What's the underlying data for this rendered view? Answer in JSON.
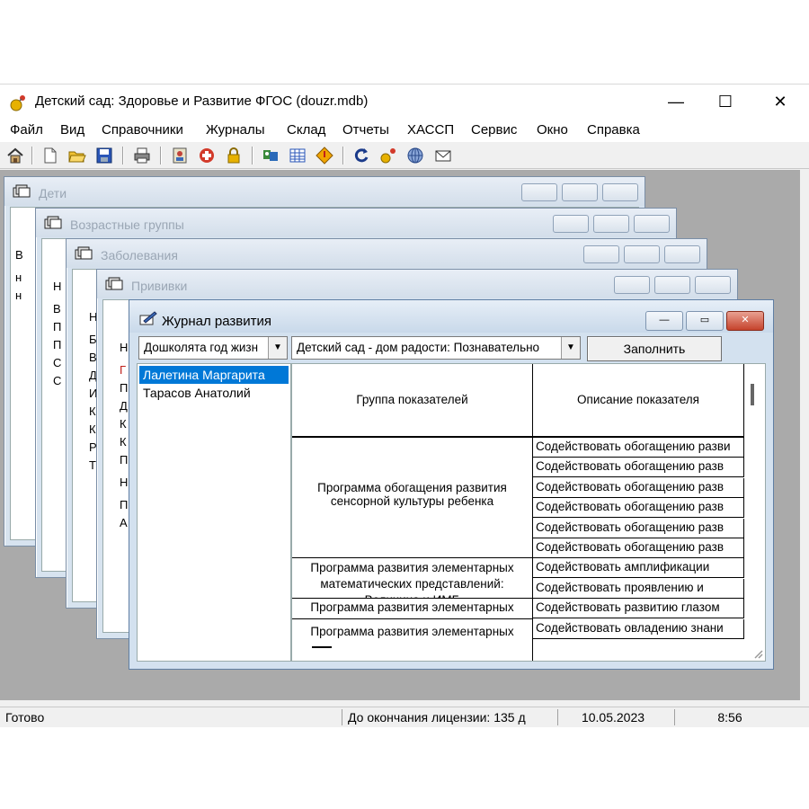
{
  "app": {
    "title": "Детский сад: Здоровье и Развитие ФГОС (douzr.mdb)",
    "controls": {
      "minimize": "—",
      "maximize": "☐",
      "close": "✕"
    }
  },
  "menu": [
    "Файл",
    "Вид",
    "Справочники",
    "Журналы",
    "Склад",
    "Отчеты",
    "ХАССП",
    "Сервис",
    "Окно",
    "Справка"
  ],
  "toolbar_icons": [
    "home-icon",
    "new-icon",
    "open-folder-icon",
    "save-icon",
    "print-icon",
    "user-card-icon",
    "medical-icon",
    "lock-icon",
    "users-icon",
    "table-icon",
    "diamond-icon",
    "refresh-icon",
    "key-icon",
    "network-icon",
    "mail-icon"
  ],
  "background_windows": [
    {
      "title": "Дети",
      "rows": [
        "В",
        "н",
        "н"
      ]
    },
    {
      "title": "Возрастные группы",
      "rows": [
        "Н",
        "В",
        "П",
        "П",
        "С",
        "С"
      ]
    },
    {
      "title": "Заболевания",
      "rows": [
        "Н",
        "Б",
        "В",
        "Д",
        "И",
        "К",
        "К",
        "Р",
        "Т"
      ]
    },
    {
      "title": "Прививки",
      "rows": [
        "Н",
        "Г",
        "П",
        "Д",
        "К",
        "К",
        "П",
        "Н",
        "П",
        "А"
      ]
    }
  ],
  "main_window": {
    "title": "Журнал развития",
    "controls": {
      "minimize": "—",
      "restore": "▭",
      "close": "✕"
    },
    "combo_age": "Дошколята год жизн",
    "combo_program": "Детский сад - дом радости: Познавательно",
    "fill_button": "Заполнить",
    "children": [
      "Лалетина Маргарита",
      "Тарасов Анатолий"
    ],
    "grid": {
      "headers": [
        "Группа показателей",
        "Описание показателя"
      ],
      "groups": [
        "Программа обогащения развития сенсорной культуры ребенка",
        "Программа развития элементарных математических представлений: Величина и ИМБ",
        "Программа развития элементарных",
        "Программа развития элементарных"
      ],
      "descriptions": [
        "Содействовать обогащению разви",
        "Содействовать обогащению разв",
        "Содействовать обогащению разв",
        "Содействовать обогащению разв",
        "Содействовать обогащению разв",
        "Содействовать обогащению разв",
        "Содействовать амплификации",
        "Содействовать проявлению и",
        "Содействовать развитию глазом",
        "Содействовать овладению знани"
      ]
    }
  },
  "status": {
    "ready": "Готово",
    "license": "До окончания лицензии: 135 д",
    "date": "10.05.2023",
    "time": "8:56"
  }
}
